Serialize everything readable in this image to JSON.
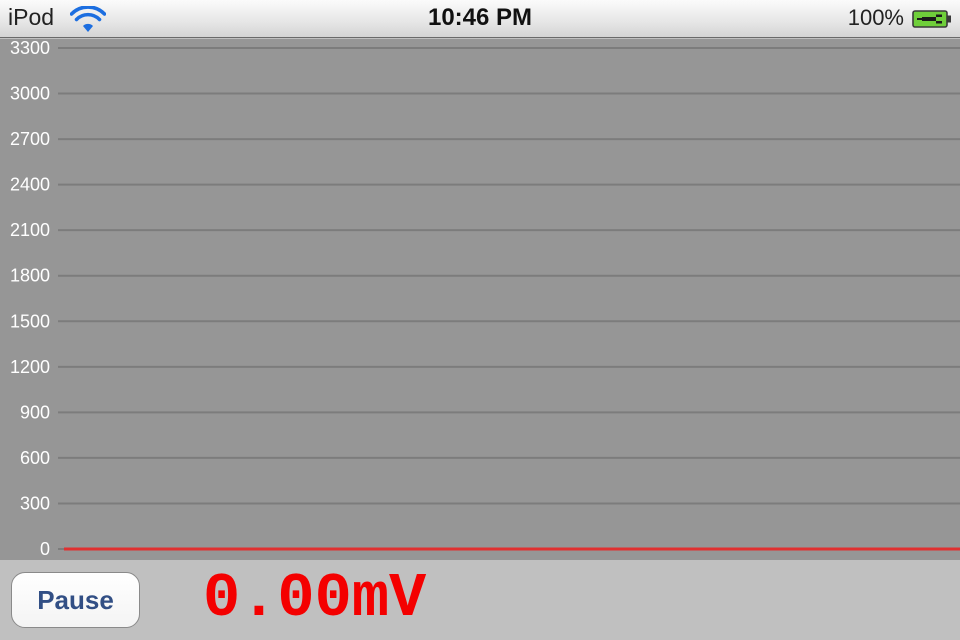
{
  "status_bar": {
    "carrier": "iPod",
    "wifi_icon": "wifi-icon",
    "time": "10:46 PM",
    "battery_percent": "100%",
    "battery_icon": "battery-charging-icon"
  },
  "plot": {
    "y_ticks": [
      "3300",
      "3000",
      "2700",
      "2400",
      "2100",
      "1800",
      "1500",
      "1200",
      "900",
      "600",
      "300",
      "0"
    ],
    "y_range": [
      0,
      3300
    ],
    "signal_value": 0,
    "colors": {
      "background": "#969696",
      "gridline": "#7c7c7c",
      "tick_text": "#ffffff",
      "signal": "#e03030"
    }
  },
  "controls": {
    "pause_label": "Pause",
    "readout": "0.00mV",
    "readout_color": "#f40000"
  }
}
